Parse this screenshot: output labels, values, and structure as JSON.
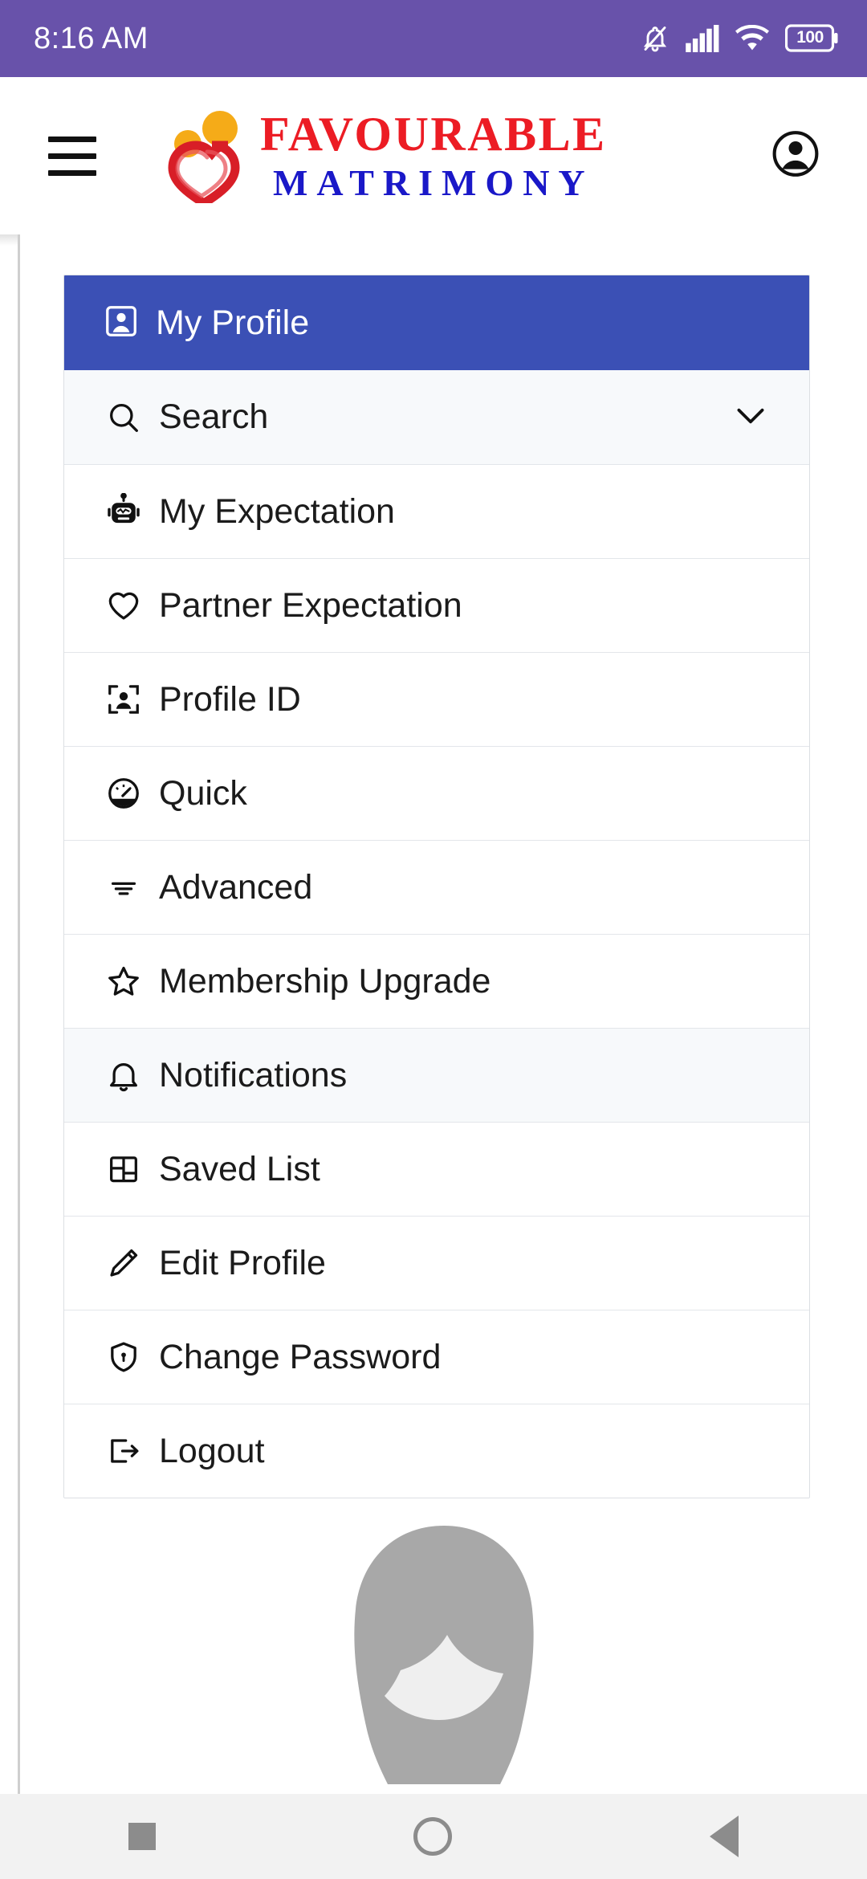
{
  "status_bar": {
    "time": "8:16 AM",
    "battery_level": "100",
    "icons": [
      "bell-muted-icon",
      "signal-bars-icon",
      "wifi-icon",
      "battery-icon"
    ],
    "background_color": "#6852aa"
  },
  "header": {
    "menu_icon": "hamburger-menu-icon",
    "account_icon": "account-circle-icon",
    "logo": {
      "line1": "FAVOURABLE",
      "line2": "MATRIMONY",
      "line1_color": "#ec1c24",
      "line2_color": "#1a18c8",
      "mark": "heart-people-logo"
    }
  },
  "menu": {
    "header": {
      "label": "My Profile",
      "icon": "account-box-icon",
      "background_color": "#3b50b5"
    },
    "search": {
      "label": "Search",
      "icon": "search-icon",
      "expand_icon": "chevron-down-icon",
      "expanded": false
    },
    "items": [
      {
        "label": "My Expectation",
        "icon": "robot-icon"
      },
      {
        "label": "Partner Expectation",
        "icon": "heart-outline-icon"
      },
      {
        "label": "Profile ID",
        "icon": "person-scan-icon"
      },
      {
        "label": "Quick",
        "icon": "speedometer-icon"
      },
      {
        "label": "Advanced",
        "icon": "filter-lines-icon"
      },
      {
        "label": "Membership Upgrade",
        "icon": "star-outline-icon"
      },
      {
        "label": "Notifications",
        "icon": "bell-icon"
      },
      {
        "label": "Saved List",
        "icon": "dashboard-grid-icon"
      },
      {
        "label": "Edit Profile",
        "icon": "pencil-icon"
      },
      {
        "label": "Change Password",
        "icon": "shield-lock-icon"
      },
      {
        "label": "Logout",
        "icon": "logout-icon"
      }
    ]
  },
  "avatar_placeholder": {
    "icon": "person-silhouette-placeholder"
  },
  "nav_bar": {
    "recent_label": "recents-button",
    "home_label": "home-button",
    "back_label": "back-button"
  }
}
